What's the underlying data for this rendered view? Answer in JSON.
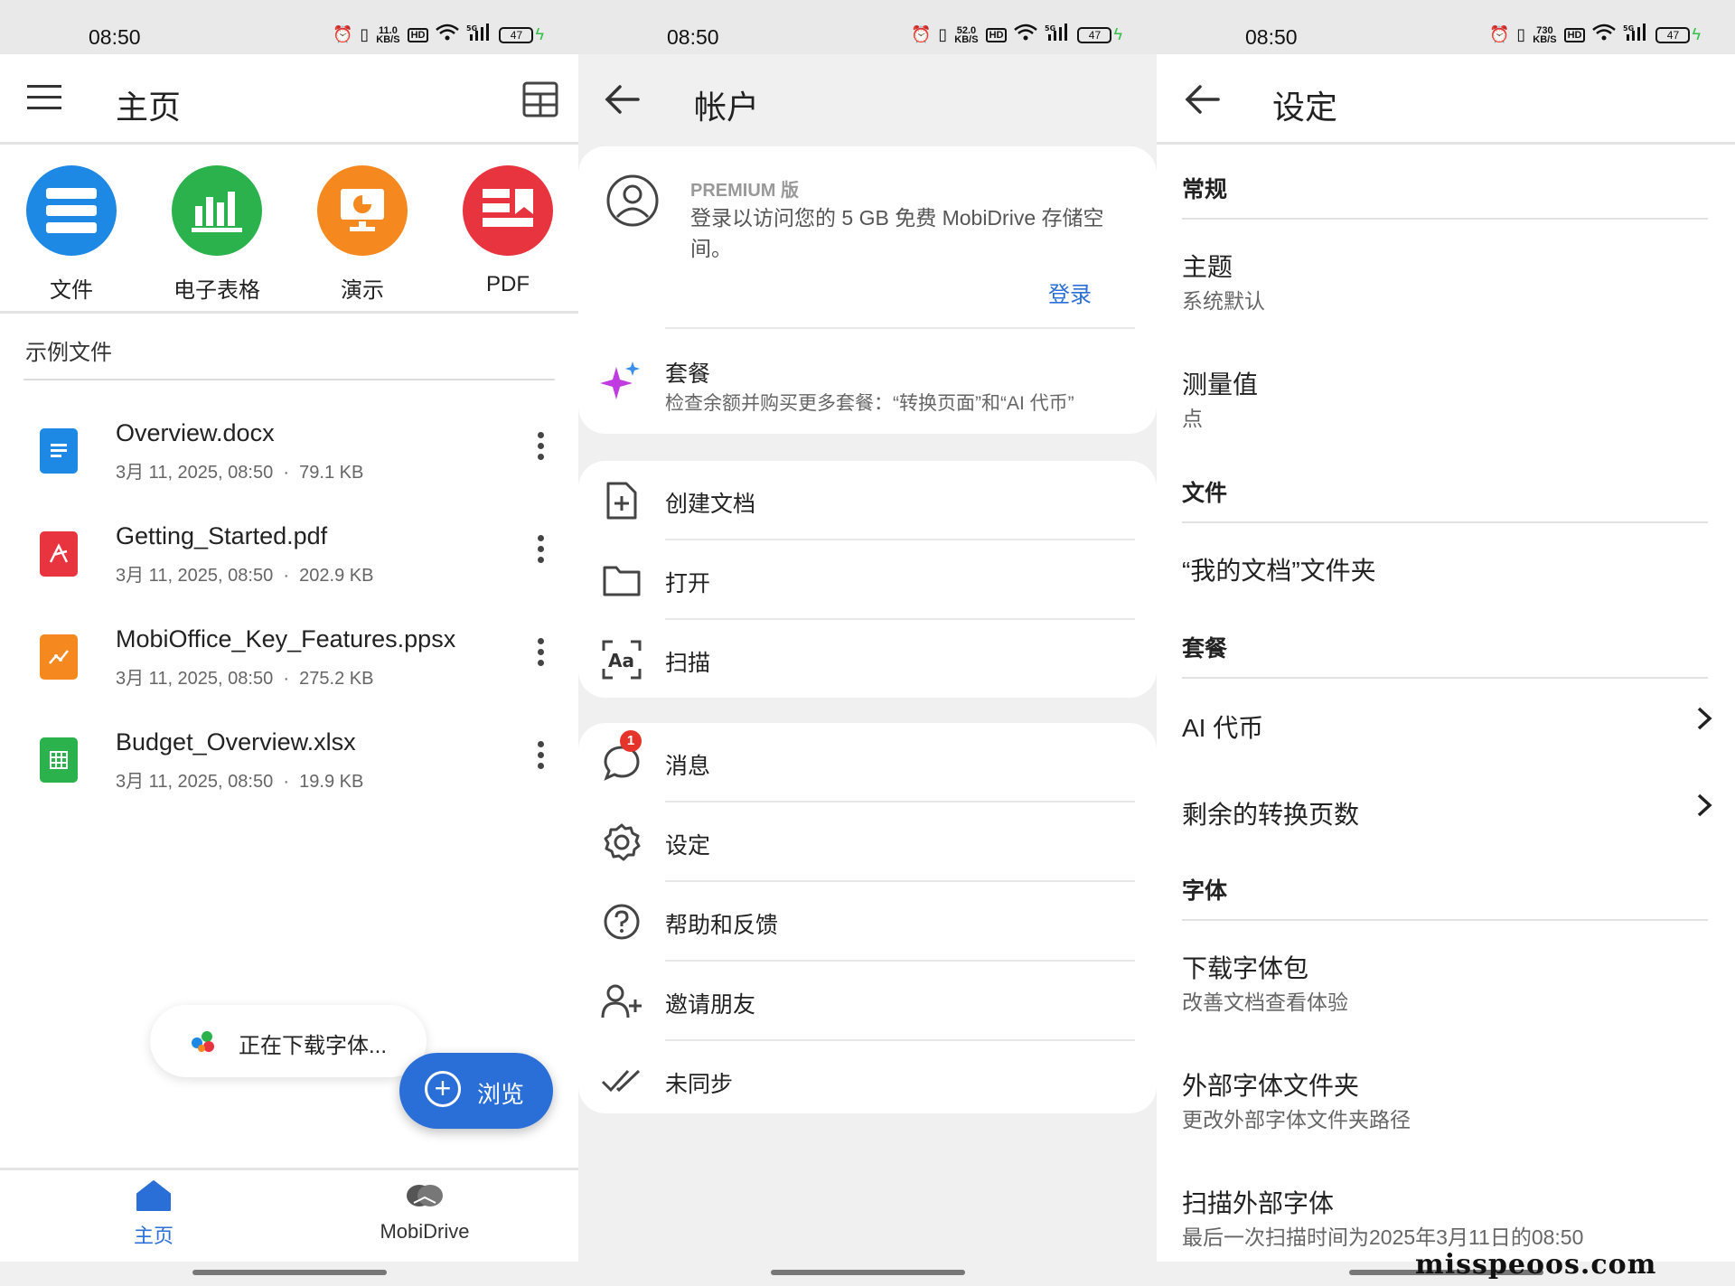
{
  "status": {
    "time": "08:50",
    "battery": "47",
    "net_speeds": [
      "11.0",
      "52.0",
      "730"
    ],
    "net_unit": "KB/S",
    "hd": "HD",
    "signal": "5G"
  },
  "home": {
    "title": "主页",
    "quick_actions": [
      {
        "label": "文件",
        "color": "#1e88e5"
      },
      {
        "label": "电子表格",
        "color": "#2bb24c"
      },
      {
        "label": "演示",
        "color": "#f5891f"
      },
      {
        "label": "PDF",
        "color": "#e8343f"
      }
    ],
    "section_title": "示例文件",
    "files": [
      {
        "name": "Overview.docx",
        "date": "3月 11, 2025, 08:50",
        "size": "79.1 KB",
        "color": "#1e88e5"
      },
      {
        "name": "Getting_Started.pdf",
        "date": "3月 11, 2025, 08:50",
        "size": "202.9 KB",
        "color": "#e8343f"
      },
      {
        "name": "MobiOffice_Key_Features.ppsx",
        "date": "3月 11, 2025, 08:50",
        "size": "275.2 KB",
        "color": "#f5891f"
      },
      {
        "name": "Budget_Overview.xlsx",
        "date": "3月 11, 2025, 08:50",
        "size": "19.9 KB",
        "color": "#2bb24c"
      }
    ],
    "meta_separator": "·",
    "toast": "正在下载字体...",
    "fab_label": "浏览",
    "nav": [
      {
        "label": "主页",
        "active": true
      },
      {
        "label": "MobiDrive",
        "active": false
      }
    ]
  },
  "account": {
    "title": "帐户",
    "premium_label": "PREMIUM 版",
    "premium_desc": "登录以访问您的 5 GB 免费 MobiDrive 存储空间。",
    "login": "登录",
    "plan_title": "套餐",
    "plan_desc": "检查余额并购买更多套餐：“转换页面”和“AI 代币”",
    "menu_group1": [
      "创建文档",
      "打开",
      "扫描"
    ],
    "menu_group2": [
      "消息",
      "设定",
      "帮助和反馈",
      "邀请朋友",
      "未同步"
    ],
    "message_badge": "1"
  },
  "settings": {
    "title": "设定",
    "general": "常规",
    "theme_title": "主题",
    "theme_value": "系统默认",
    "measure_title": "测量值",
    "measure_value": "点",
    "files_header": "文件",
    "my_docs": "“我的文档”文件夹",
    "plan_header": "套餐",
    "ai_tokens": "AI 代币",
    "pages_left": "剩余的转换页数",
    "fonts_header": "字体",
    "download_fonts": "下载字体包",
    "download_fonts_sub": "改善文档查看体验",
    "ext_folder": "外部字体文件夹",
    "ext_folder_sub": "更改外部字体文件夹路径",
    "scan_fonts": "扫描外部字体",
    "scan_fonts_sub": "最后一次扫描时间为2025年3月11日的08:50"
  },
  "watermark": "misspeoos.com"
}
